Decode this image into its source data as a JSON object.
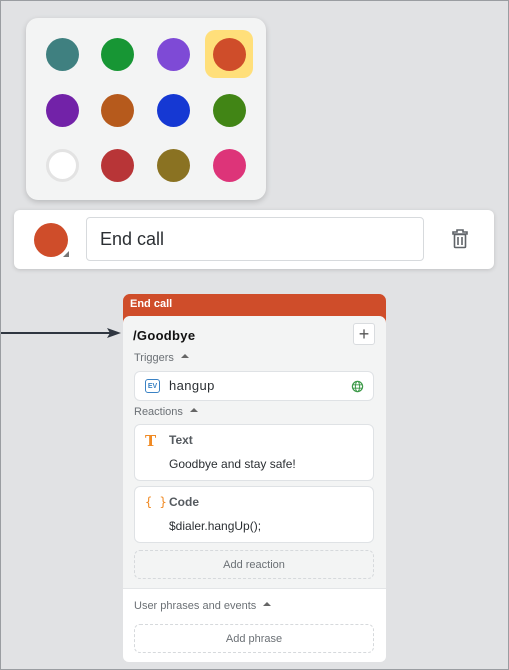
{
  "palette": {
    "colors": [
      {
        "name": "teal",
        "hex": "#3f8080"
      },
      {
        "name": "green",
        "hex": "#179634"
      },
      {
        "name": "lavender",
        "hex": "#7e4ad6"
      },
      {
        "name": "orange-red",
        "hex": "#cf4d2a",
        "selected": true
      },
      {
        "name": "purple",
        "hex": "#7222a8"
      },
      {
        "name": "brown-orange",
        "hex": "#b65a1c"
      },
      {
        "name": "blue",
        "hex": "#1538d3"
      },
      {
        "name": "olive-green",
        "hex": "#418515"
      },
      {
        "name": "white",
        "hex": "#ffffff"
      },
      {
        "name": "red",
        "hex": "#b83537"
      },
      {
        "name": "olive",
        "hex": "#8a7222"
      },
      {
        "name": "pink",
        "hex": "#dd3479"
      }
    ],
    "selected_highlight": "#ffdf7a"
  },
  "namebar": {
    "selected_color": "#cf4d2a",
    "name_value": "End call",
    "delete_icon": "trash-icon"
  },
  "card": {
    "title": "End call",
    "accent": "#cf4d2a",
    "state_name": "/Goodbye",
    "add_label": "+",
    "triggers_label": "Triggers",
    "triggers": [
      {
        "type_badge": "EV",
        "name": "hangup",
        "scope_icon": "globe-icon"
      }
    ],
    "reactions_label": "Reactions",
    "reactions": [
      {
        "icon": "T",
        "type": "Text",
        "content": "Goodbye and stay safe!"
      },
      {
        "icon": "{ }",
        "type": "Code",
        "content": "$dialer.hangUp();"
      }
    ],
    "add_reaction_label": "Add reaction",
    "phrases_label": "User phrases and events",
    "add_phrase_label": "Add phrase"
  }
}
